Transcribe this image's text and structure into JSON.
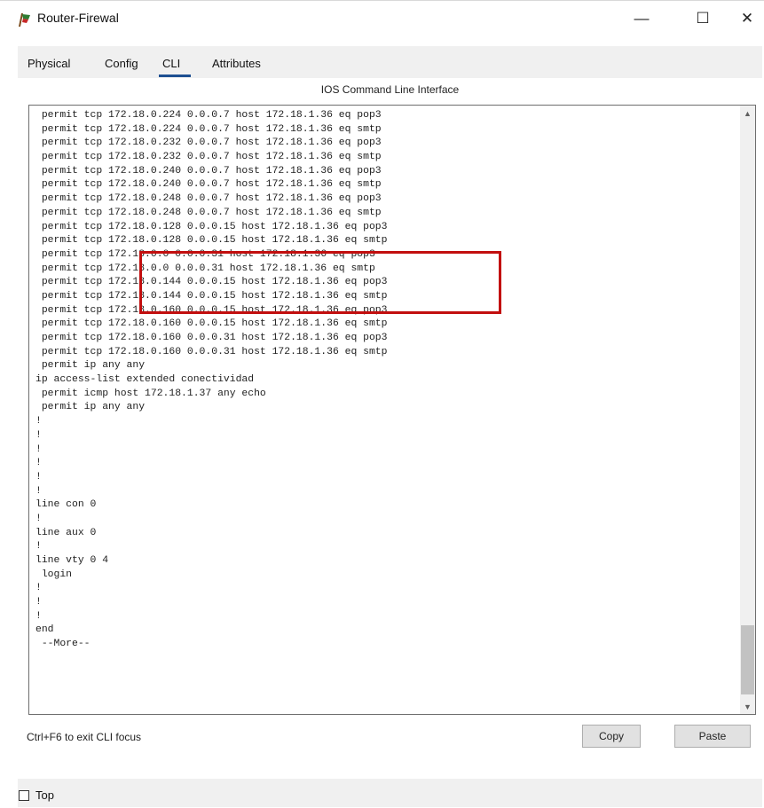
{
  "window": {
    "title": "Router-Firewal",
    "app_icon": "router-icon",
    "controls": {
      "minimize": "—",
      "maximize": "☐",
      "close": "✕"
    }
  },
  "tabs": [
    {
      "label": "Physical"
    },
    {
      "label": "Config"
    },
    {
      "label": "CLI",
      "selected": true
    },
    {
      "label": "Attributes"
    }
  ],
  "panel": {
    "title": "IOS Command Line Interface"
  },
  "cli": {
    "lines": [
      " permit tcp 172.18.0.224 0.0.0.7 host 172.18.1.36 eq pop3",
      " permit tcp 172.18.0.224 0.0.0.7 host 172.18.1.36 eq smtp",
      " permit tcp 172.18.0.232 0.0.0.7 host 172.18.1.36 eq pop3",
      " permit tcp 172.18.0.232 0.0.0.7 host 172.18.1.36 eq smtp",
      " permit tcp 172.18.0.240 0.0.0.7 host 172.18.1.36 eq pop3",
      " permit tcp 172.18.0.240 0.0.0.7 host 172.18.1.36 eq smtp",
      " permit tcp 172.18.0.248 0.0.0.7 host 172.18.1.36 eq pop3",
      " permit tcp 172.18.0.248 0.0.0.7 host 172.18.1.36 eq smtp",
      " permit tcp 172.18.0.128 0.0.0.15 host 172.18.1.36 eq pop3",
      " permit tcp 172.18.0.128 0.0.0.15 host 172.18.1.36 eq smtp",
      " permit tcp 172.18.0.0 0.0.0.31 host 172.18.1.36 eq pop3",
      " permit tcp 172.18.0.0 0.0.0.31 host 172.18.1.36 eq smtp",
      " permit tcp 172.18.0.144 0.0.0.15 host 172.18.1.36 eq pop3",
      " permit tcp 172.18.0.144 0.0.0.15 host 172.18.1.36 eq smtp",
      " permit tcp 172.18.0.160 0.0.0.15 host 172.18.1.36 eq pop3",
      " permit tcp 172.18.0.160 0.0.0.15 host 172.18.1.36 eq smtp",
      " permit tcp 172.18.0.160 0.0.0.31 host 172.18.1.36 eq pop3",
      " permit tcp 172.18.0.160 0.0.0.31 host 172.18.1.36 eq smtp",
      " permit ip any any",
      "ip access-list extended conectividad",
      " permit icmp host 172.18.1.37 any echo",
      " permit ip any any",
      "!",
      "!",
      "!",
      "!",
      "!",
      "!",
      "line con 0",
      "!",
      "line aux 0",
      "!",
      "line vty 0 4",
      " login",
      "!",
      "!",
      "!",
      "end",
      " --More--"
    ],
    "highlight_color": "#c20e0e"
  },
  "footer": {
    "hint": "Ctrl+F6 to exit CLI focus",
    "copy_label": "Copy",
    "paste_label": "Paste"
  },
  "bottom": {
    "checkbox_label": "Top",
    "checked": false
  },
  "colors": {
    "tab_underline": "#1d4f91",
    "window_bg": "#f0f0f0"
  }
}
